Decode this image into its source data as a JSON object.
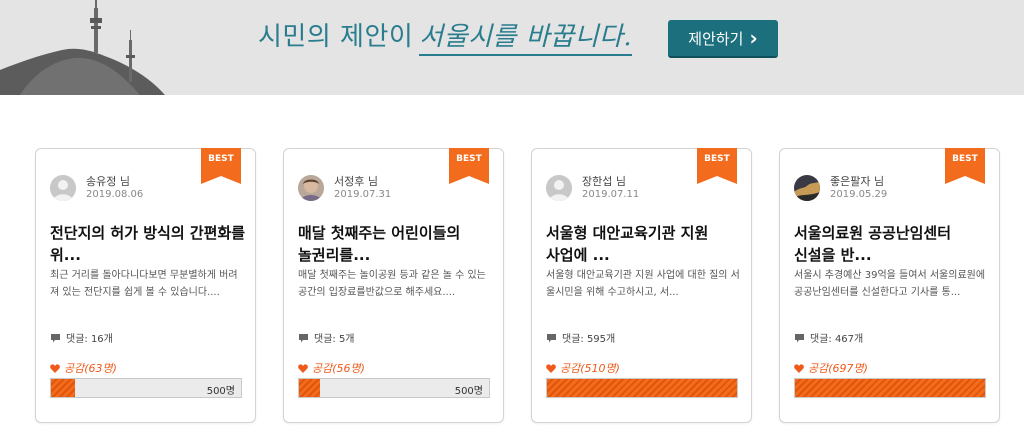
{
  "banner": {
    "slogan_main": "시민의 제안이",
    "slogan_emphasis": "서울시를 바꿉니다.",
    "propose_button": "제안하기",
    "propose_chevron": "›",
    "colors": {
      "background": "#e4e4e4",
      "slogan": "#2a7d8e",
      "button": "#1c6f7d"
    }
  },
  "cards": [
    {
      "badge": "BEST",
      "author": "송유정 님",
      "date": "2019.08.06",
      "avatar": "default-avatar-icon",
      "title": "전단지의 허가 방식의 간편화를 위...",
      "excerpt": "최근 거리를 돌아다니다보면 무분별하게 버려져 있는 전단지를 쉽게 볼 수 있습니다....",
      "comments": "댓글: 16개",
      "likes": "공감(63명)",
      "like_count": 63,
      "target_label": "500명",
      "target": 500
    },
    {
      "badge": "BEST",
      "author": "서정후 님",
      "date": "2019.07.31",
      "avatar": "photo-avatar-icon",
      "title": "매달 첫째주는 어린이들의 놀권리를...",
      "excerpt": "매달 첫째주는 놀이공원 등과 같은 놀 수 있는 공간의 입장료를반값으로 해주세요....",
      "comments": "댓글: 5개",
      "likes": "공감(56명)",
      "like_count": 56,
      "target_label": "500명",
      "target": 500
    },
    {
      "badge": "BEST",
      "author": "장한섭 님",
      "date": "2019.07.11",
      "avatar": "default-avatar-icon",
      "title": "서울형 대안교육기관 지원 사업에 ...",
      "excerpt": "서울형 대안교육기관 지원 사업에 대한 질의 서울시민을 위해 수고하시고, 서...",
      "comments": "댓글: 595개",
      "likes": "공감(510명)",
      "like_count": 510,
      "target_label": "",
      "target": 500
    },
    {
      "badge": "BEST",
      "author": "좋은팔자 님",
      "date": "2019.05.29",
      "avatar": "photo-avatar-icon",
      "title": "서울의료원 공공난임센터 신설을 반...",
      "excerpt": "서울시 추경예산 39억을 들여서 서울의료원에 공공난임센터를 신설한다고 기사를 통...",
      "comments": "댓글: 467개",
      "likes": "공감(697명)",
      "like_count": 697,
      "target_label": "",
      "target": 500
    }
  ],
  "colors": {
    "accent": "#f36b1c",
    "likes_text": "#ee5a1a"
  }
}
